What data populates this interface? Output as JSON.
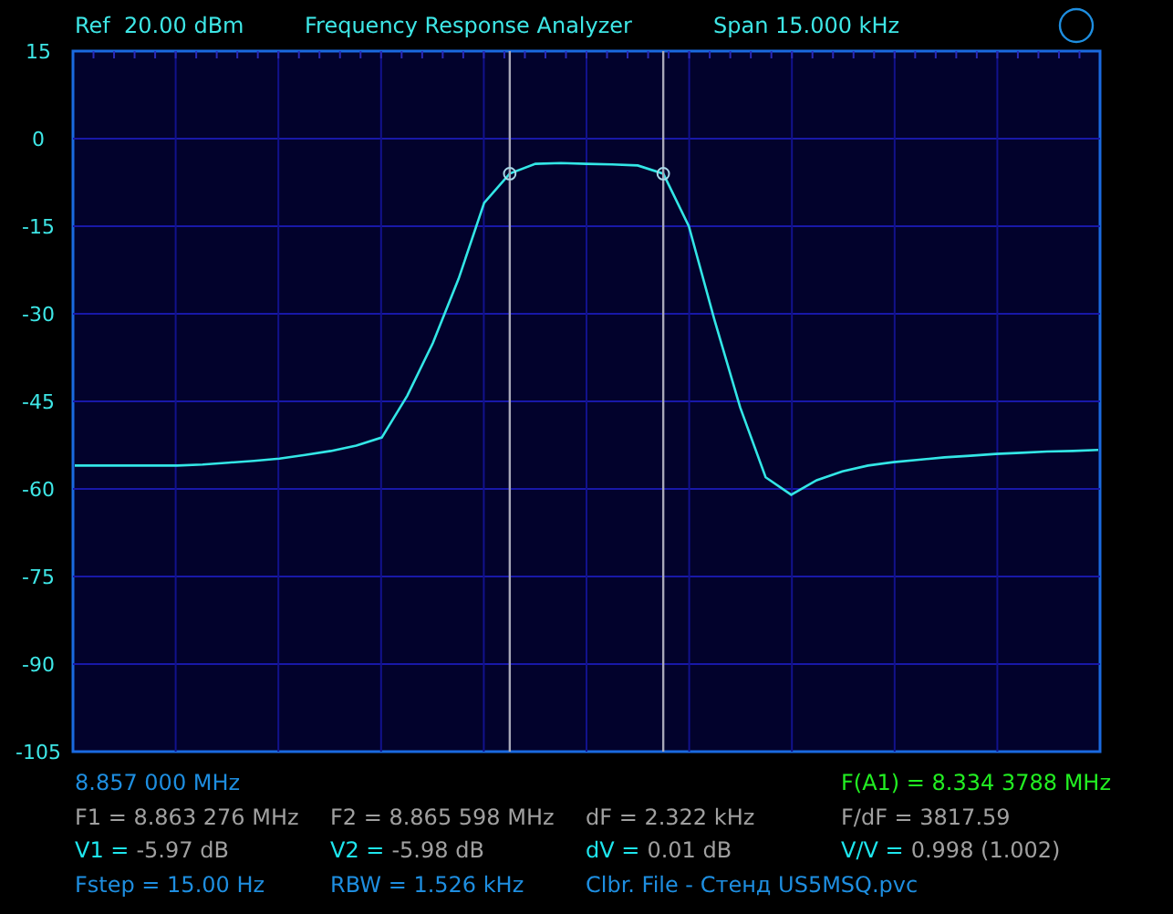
{
  "header": {
    "ref": "Ref  20.00 dBm",
    "title": "Frequency Response Analyzer",
    "span": "Span 15.000 kHz"
  },
  "chart": {
    "chart_data": {
      "type": "line",
      "ylim": [
        -105,
        15
      ],
      "yticks": [
        15,
        0,
        -15,
        -30,
        -45,
        -60,
        -75,
        -90,
        -105
      ],
      "grid": true,
      "series": [
        {
          "color": "#33e6e6",
          "values": [
            -56,
            -56,
            -56,
            -56,
            -56,
            -55.8,
            -55.5,
            -55.2,
            -54.8,
            -54.2,
            -53.5,
            -52.6,
            -51.2,
            -44,
            -35,
            -24,
            -11,
            -6,
            -4.3,
            -4.2,
            -4.3,
            -4.4,
            -4.6,
            -6,
            -15,
            -31,
            -46,
            -58,
            -61,
            -58.5,
            -57,
            -56,
            -55.4,
            -55,
            -54.6,
            -54.3,
            -54,
            -53.8,
            -53.6,
            -53.5,
            -53.3
          ]
        }
      ]
    },
    "markers": [
      {
        "level": 0.425
      },
      {
        "level": 0.575
      }
    ]
  },
  "footer": {
    "frequency": "8.857 000 MHz",
    "marker_frequency": "F(A1) = 8.334 3788 MHz",
    "rows": [
      [
        {
          "kind": "reading",
          "label": "F1 = 8.863 276 MHz"
        },
        {
          "kind": "reading",
          "label": "F2 = 8.865 598 MHz"
        },
        {
          "kind": "reading",
          "label": "dF = 2.322 kHz"
        },
        {
          "kind": "reading",
          "label": "F/dF = 3817.59"
        }
      ],
      [
        {
          "kind": "level",
          "label": "V1 =",
          "value": "-5.97 dB"
        },
        {
          "kind": "level",
          "label": "V2 =",
          "value": "-5.98 dB"
        },
        {
          "kind": "level",
          "label": "dV =",
          "value": "0.01 dB"
        },
        {
          "kind": "level",
          "label": "V/V =",
          "value": "0.998 (1.002)"
        }
      ],
      [
        {
          "kind": "info",
          "label": "Fstep = 15.00 Hz"
        },
        {
          "kind": "info",
          "label": "RBW = 1.526 kHz"
        },
        {
          "kind": "info",
          "label": "Clbr. File - Стенд US5MSQ.pvc"
        }
      ]
    ]
  }
}
